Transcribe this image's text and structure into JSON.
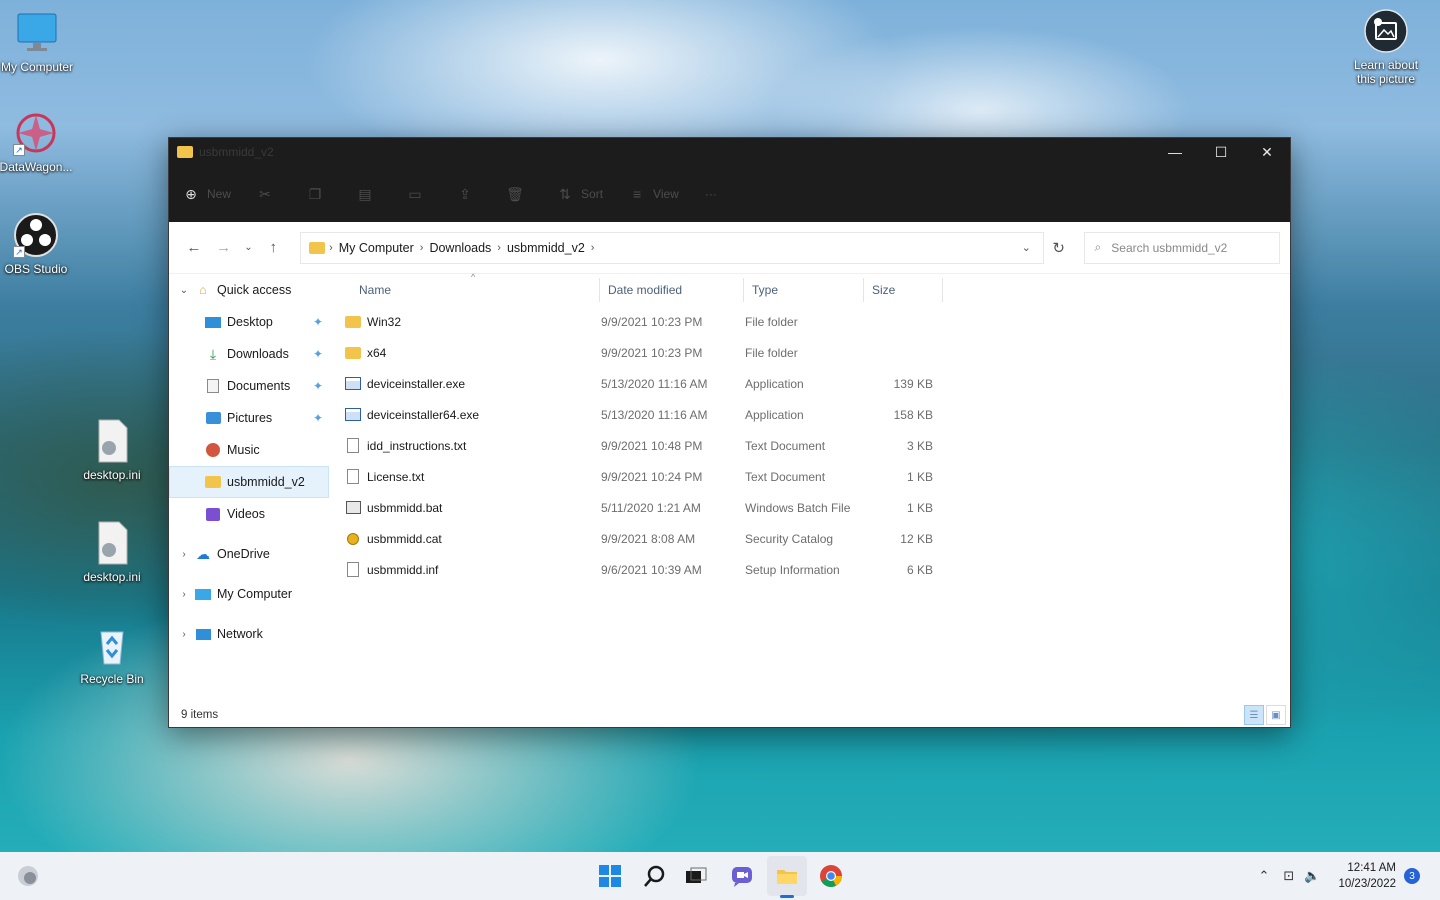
{
  "desktop": {
    "icons": [
      {
        "label": "My Computer"
      },
      {
        "label": "DataWagon..."
      },
      {
        "label": "OBS Studio"
      },
      {
        "label": "desktop.ini"
      },
      {
        "label": "desktop.ini"
      },
      {
        "label": "Recycle Bin"
      }
    ],
    "learn": {
      "line1": "Learn about",
      "line2": "this picture"
    }
  },
  "window": {
    "title": "usbmmidd_v2",
    "controls": {
      "minimize": "—",
      "maximize": "☐",
      "close": "✕"
    },
    "commands": {
      "new": "New",
      "sort": "Sort",
      "view": "View",
      "more": "···"
    },
    "address": {
      "crumbs": [
        "My Computer",
        "Downloads",
        "usbmmidd_v2"
      ]
    },
    "search": {
      "placeholder": "Search usbmmidd_v2"
    },
    "nav": {
      "quick_access": "Quick access",
      "items": [
        "Desktop",
        "Downloads",
        "Documents",
        "Pictures",
        "Music",
        "usbmmidd_v2",
        "Videos"
      ],
      "onedrive": "OneDrive",
      "my_computer": "My Computer",
      "network": "Network"
    },
    "columns": {
      "name": "Name",
      "date": "Date modified",
      "type": "Type",
      "size": "Size"
    },
    "files": [
      {
        "name": "Win32",
        "date": "9/9/2021 10:23 PM",
        "type": "File folder",
        "size": ""
      },
      {
        "name": "x64",
        "date": "9/9/2021 10:23 PM",
        "type": "File folder",
        "size": ""
      },
      {
        "name": "deviceinstaller.exe",
        "date": "5/13/2020 11:16 AM",
        "type": "Application",
        "size": "139 KB"
      },
      {
        "name": "deviceinstaller64.exe",
        "date": "5/13/2020 11:16 AM",
        "type": "Application",
        "size": "158 KB"
      },
      {
        "name": "idd_instructions.txt",
        "date": "9/9/2021 10:48 PM",
        "type": "Text Document",
        "size": "3 KB"
      },
      {
        "name": "License.txt",
        "date": "9/9/2021 10:24 PM",
        "type": "Text Document",
        "size": "1 KB"
      },
      {
        "name": "usbmmidd.bat",
        "date": "5/11/2020 1:21 AM",
        "type": "Windows Batch File",
        "size": "1 KB"
      },
      {
        "name": "usbmmidd.cat",
        "date": "9/9/2021 8:08 AM",
        "type": "Security Catalog",
        "size": "12 KB"
      },
      {
        "name": "usbmmidd.inf",
        "date": "9/6/2021 10:39 AM",
        "type": "Setup Information",
        "size": "6 KB"
      }
    ],
    "status": "9 items"
  },
  "taskbar": {
    "time": "12:41 AM",
    "date": "10/23/2022",
    "notifications": "3"
  }
}
